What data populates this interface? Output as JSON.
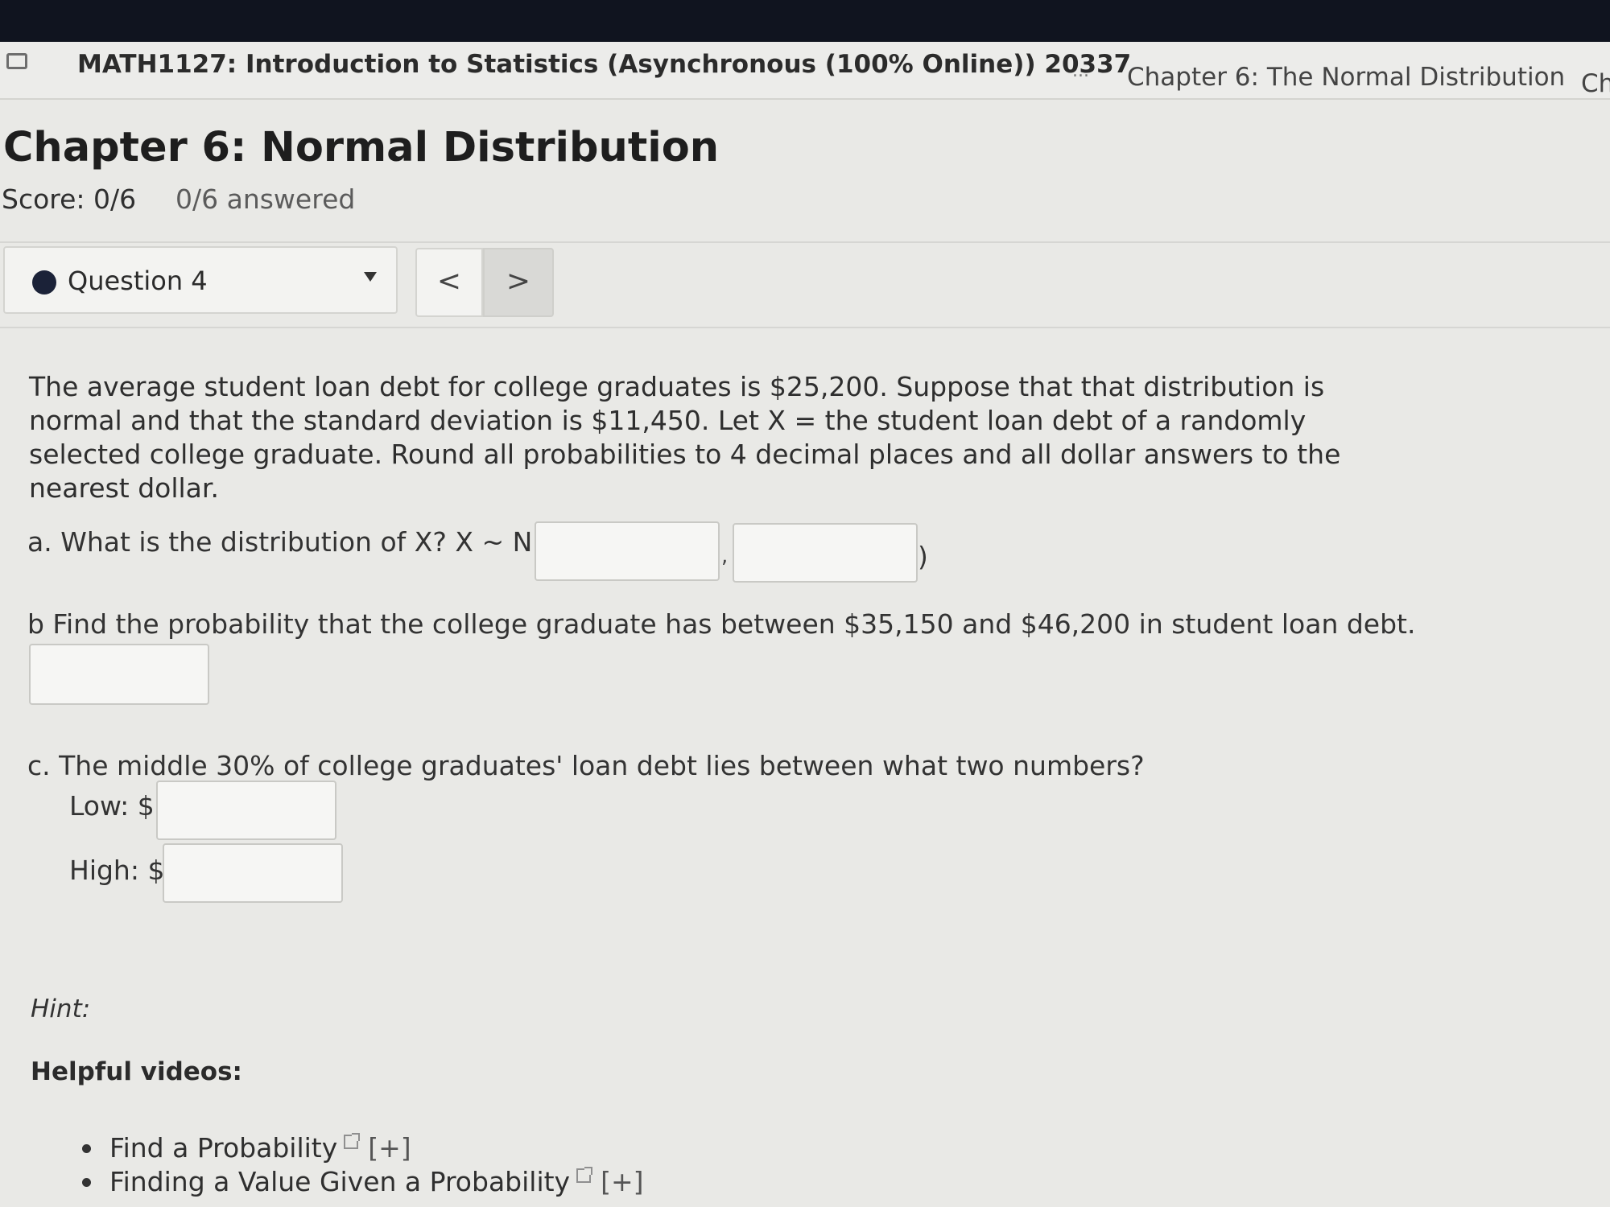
{
  "header": {
    "course_title": "MATH1127: Introduction to Statistics (Asynchronous (100% Online)) 20337",
    "breadcrumb_ellipsis": "...",
    "breadcrumb_chapter": "Chapter 6: The Normal Distribution",
    "breadcrumb_next": "Ch"
  },
  "page": {
    "title": "Chapter 6: Normal Distribution",
    "score": "Score: 0/6",
    "answered": "0/6 answered"
  },
  "question_nav": {
    "selected": "Question 4",
    "prev": "<",
    "next": ">"
  },
  "problem": {
    "text": "The average student loan debt for college graduates is $25,200. Suppose that that distribution is normal and that the standard deviation is $11,450. Let X = the student loan debt of a randomly selected college graduate. Round all probabilities to 4 decimal places and all dollar answers to the nearest dollar.",
    "part_a": "a. What is the distribution of X? X ~ N(",
    "part_a_comma": ",",
    "part_a_close": ")",
    "part_b": "b  Find the probability that the college graduate has between $35,150 and $46,200 in student loan debt.",
    "part_c": "c. The middle 30% of college graduates' loan debt lies between what two numbers?",
    "low_label": "Low: $",
    "high_label": "High: $",
    "inputs": {
      "mean": "",
      "sd": "",
      "probability": "",
      "low": "",
      "high": ""
    }
  },
  "help": {
    "hint_label": "Hint:",
    "videos_label": "Helpful videos:",
    "videos": [
      {
        "title": "Find a Probability",
        "expand": "[+]"
      },
      {
        "title": "Finding a Value Given a Probability",
        "expand": "[+]"
      }
    ]
  },
  "colors": {
    "background": "#e9e9e6",
    "top_bar": "#10141f",
    "question_dot": "#1b2238"
  }
}
